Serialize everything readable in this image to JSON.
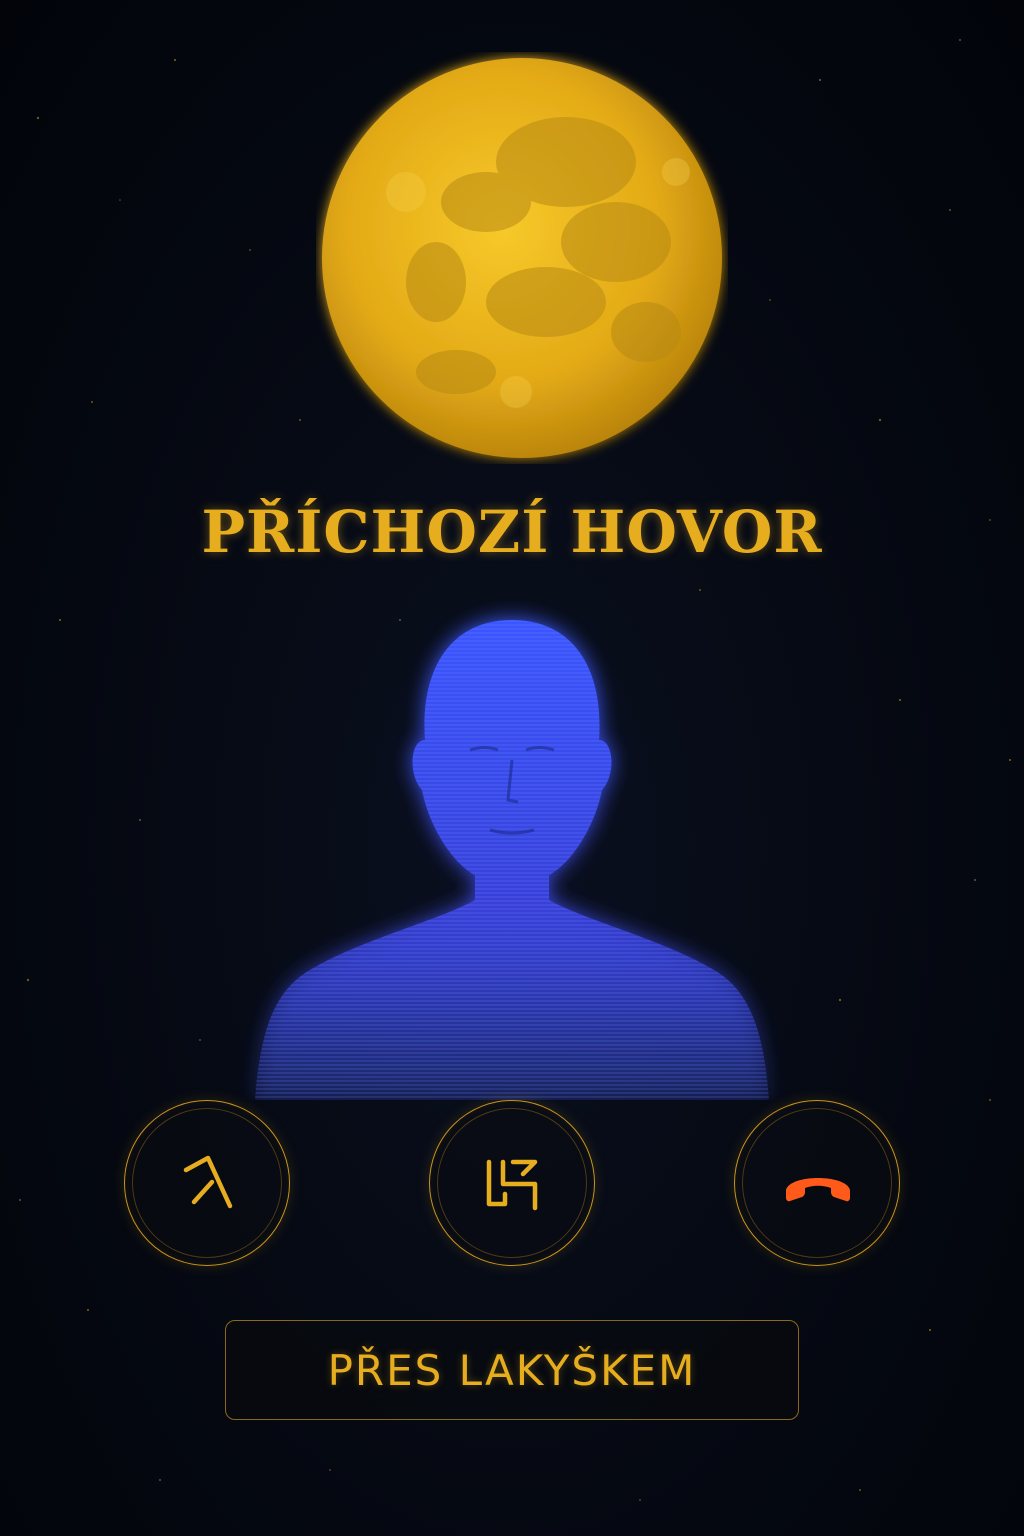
{
  "call": {
    "title": "PŘÍCHOZÍ HOVOR",
    "caller_label": "PŘES LAKYŠKEM"
  },
  "actions": [
    {
      "name": "accept",
      "icon": "arrow-glyph-icon"
    },
    {
      "name": "message",
      "icon": "rune-glyph-icon"
    },
    {
      "name": "decline",
      "icon": "hang-up-phone-icon"
    }
  ],
  "colors": {
    "accent": "#e6ad1e",
    "moon": "#e7b21c",
    "avatar": "#2f4ff0",
    "decline": "#ff5a1a",
    "background": "#03060b"
  }
}
